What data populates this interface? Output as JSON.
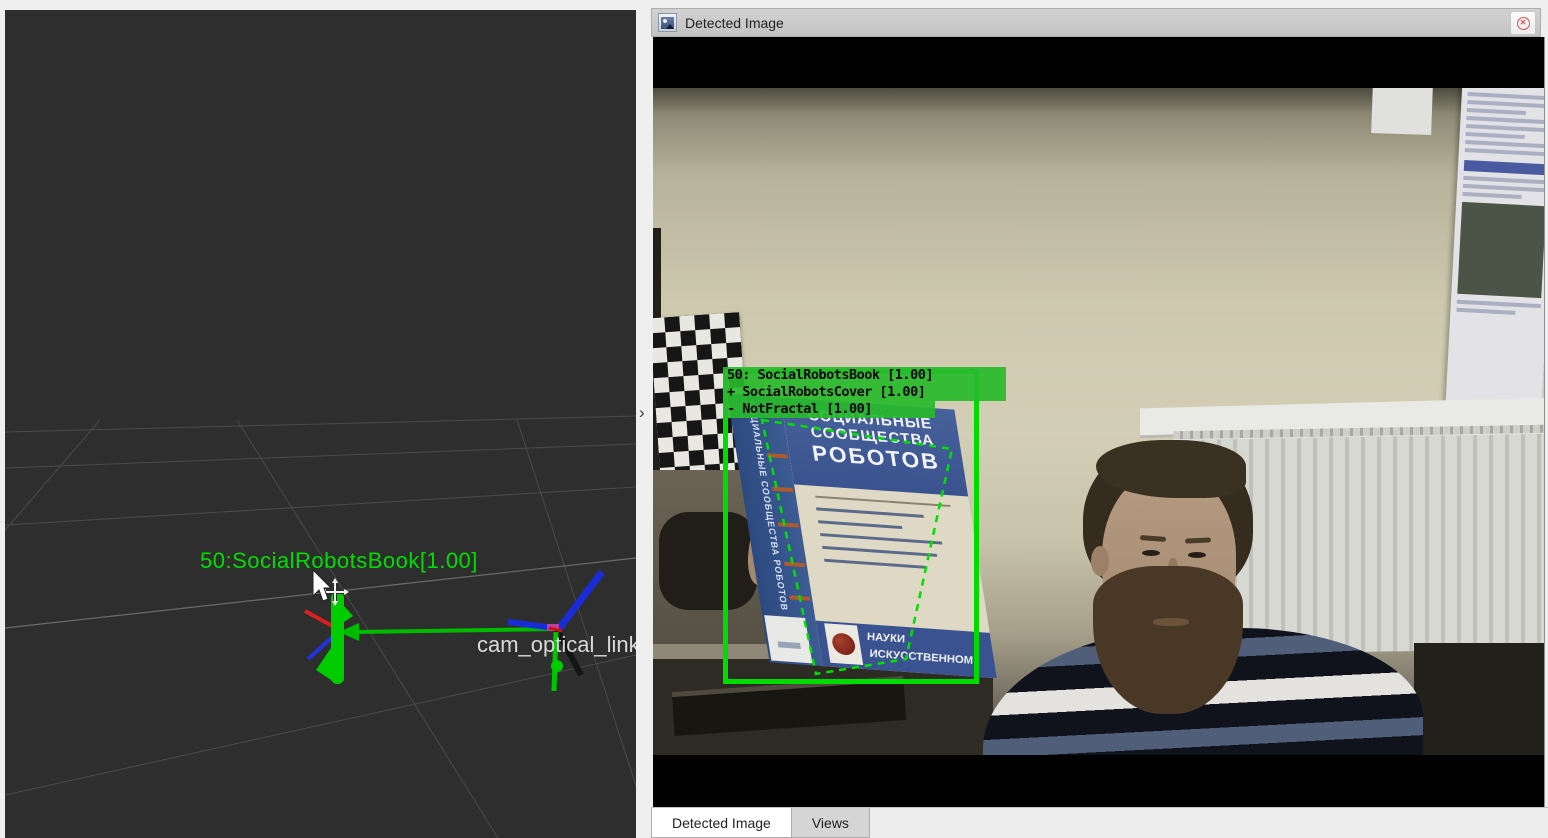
{
  "colors": {
    "detection_green": "#00dc00",
    "viewport_background": "#2e2e2e",
    "panel_gray": "#c9c9c9",
    "close_red": "#d9534f"
  },
  "left_panel": {
    "marker_label": "50:SocialRobotsBook[1.00]",
    "frame_label": "cam_optical_link"
  },
  "right_panel": {
    "title": "Detected Image",
    "close_glyph": "✕",
    "chevron_glyph": "›",
    "detections": [
      {
        "label": "50: SocialRobotsBook [1.00]"
      },
      {
        "label": "+ SocialRobotsCover [1.00]"
      },
      {
        "label": "- NotFractal [1.00]"
      }
    ],
    "book": {
      "spine_text": "СОЦИАЛЬНЫЕ СООБЩЕСТВА РОБОТОВ",
      "title_line1": "СОЦИАЛЬНЫЕ",
      "title_line2": "СООБЩЕСТВА",
      "title_line3": "РОБОТОВ",
      "publisher_line1": "НАУКИ",
      "publisher_line2": "ИСКУССТВЕННОМ"
    },
    "tabs": [
      {
        "label": "Detected Image",
        "active": true
      },
      {
        "label": "Views",
        "active": false
      }
    ]
  }
}
